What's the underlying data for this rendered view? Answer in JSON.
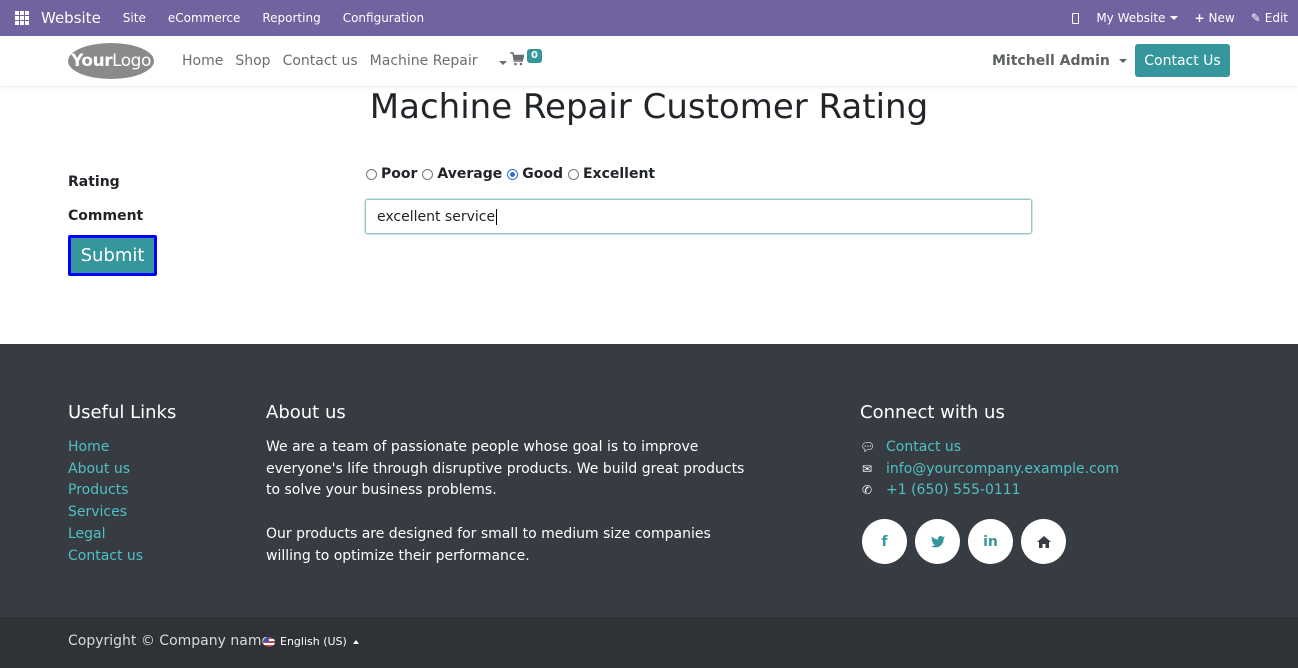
{
  "adminbar": {
    "brand": "Website",
    "menu": [
      "Site",
      "eCommerce",
      "Reporting",
      "Configuration"
    ],
    "website_selector": "My Website",
    "new_label": "New",
    "edit_label": "Edit"
  },
  "header": {
    "logo_text_bold": "Your",
    "logo_text": "Logo",
    "nav": [
      "Home",
      "Shop",
      "Contact us",
      "Machine Repair"
    ],
    "cart_count": "0",
    "user": "Mitchell Admin",
    "contact_button": "Contact Us"
  },
  "form": {
    "title": "Machine Repair Customer Rating",
    "rating_label": "Rating",
    "comment_label": "Comment",
    "rating_options": [
      "Poor",
      "Average",
      "Good",
      "Excellent"
    ],
    "rating_selected": "Good",
    "comment_value": "excellent service",
    "submit_label": "Submit"
  },
  "footer": {
    "useful_links_title": "Useful Links",
    "useful_links": [
      "Home",
      "About us",
      "Products",
      "Services",
      "Legal",
      "Contact us"
    ],
    "about_title": "About us",
    "about_p1": "We are a team of passionate people whose goal is to improve everyone's life through disruptive products. We build great products to solve your business problems.",
    "about_p2": "Our products are designed for small to medium size companies willing to optimize their performance.",
    "connect_title": "Connect with us",
    "contact_link": "Contact us",
    "email": "info@yourcompany.example.com",
    "phone": "+1 (650) 555-0111",
    "social": [
      "facebook-icon",
      "twitter-icon",
      "linkedin-icon",
      "home-icon"
    ]
  },
  "copyright": {
    "text": "Copyright © Company name",
    "language": "English (US)"
  },
  "colors": {
    "admin_bar": "#7162a0",
    "primary": "#35979c",
    "footer_bg": "#373c43",
    "copyright_bg": "#2f3338",
    "link": "#4fc0c4",
    "submit_focus_border": "#0000ff"
  }
}
